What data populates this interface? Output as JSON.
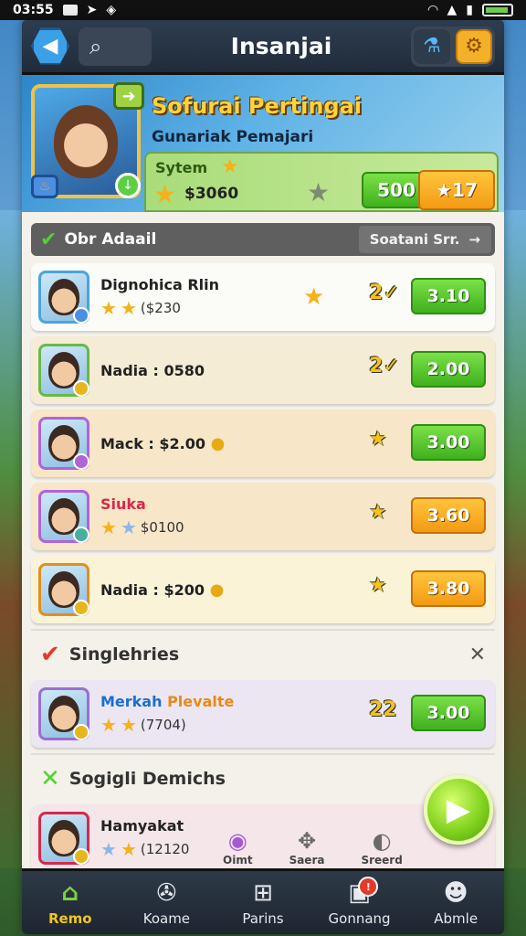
{
  "status_bar": {
    "time": "03:55"
  },
  "header": {
    "title": "Insanjai"
  },
  "banner": {
    "title": "Sofurai Pertingai",
    "subtitle": "Gunariak Pemajari",
    "panel_label": "Sytem",
    "panel_amount": "$3060",
    "button_500": "500",
    "button_17": "17"
  },
  "section": {
    "title": "Obr Adaail",
    "link": "Soatani Srr."
  },
  "rows": [
    {
      "name": "Dignohica Rlin",
      "sub": "($230",
      "level": "2",
      "button": "3.10",
      "button_color": "green",
      "bg": "white"
    },
    {
      "name": "Nadia : 0580",
      "sub": "",
      "level": "2",
      "button": "2.00",
      "button_color": "green",
      "bg": "cream"
    },
    {
      "name": "Mack : $2.00",
      "sub": "",
      "level": "",
      "button": "3.00",
      "button_color": "green",
      "bg": "peach"
    },
    {
      "name": "Siuka",
      "sub": "$0100",
      "level": "",
      "button": "3.60",
      "button_color": "orange",
      "bg": "peach"
    },
    {
      "name": "Nadia : $200",
      "sub": "",
      "level": "",
      "button": "3.80",
      "button_color": "orange",
      "bg": "yellow"
    }
  ],
  "subhead1": {
    "title": "Singlehries"
  },
  "row_extra": {
    "name_a": "Merkah",
    "name_b": "Plevalte",
    "sub": "(7704)",
    "level": "22",
    "button": "3.00"
  },
  "subhead2": {
    "title": "Sogigli Demichs"
  },
  "row_last": {
    "name": "Hamyakat",
    "sub": "(12120"
  },
  "overlay": {
    "a": "Oimt",
    "b": "Saera",
    "c": "Sreerd"
  },
  "nav": [
    {
      "label": "Remo",
      "icon": "home-icon"
    },
    {
      "label": "Koame",
      "icon": "film-icon"
    },
    {
      "label": "Parins",
      "icon": "grid-icon"
    },
    {
      "label": "Gonnang",
      "icon": "gift-icon"
    },
    {
      "label": "Abmle",
      "icon": "user-icon"
    }
  ],
  "colors": {
    "accent_green": "#3fb11d",
    "accent_orange": "#f39a14",
    "header": "#202c3a"
  }
}
